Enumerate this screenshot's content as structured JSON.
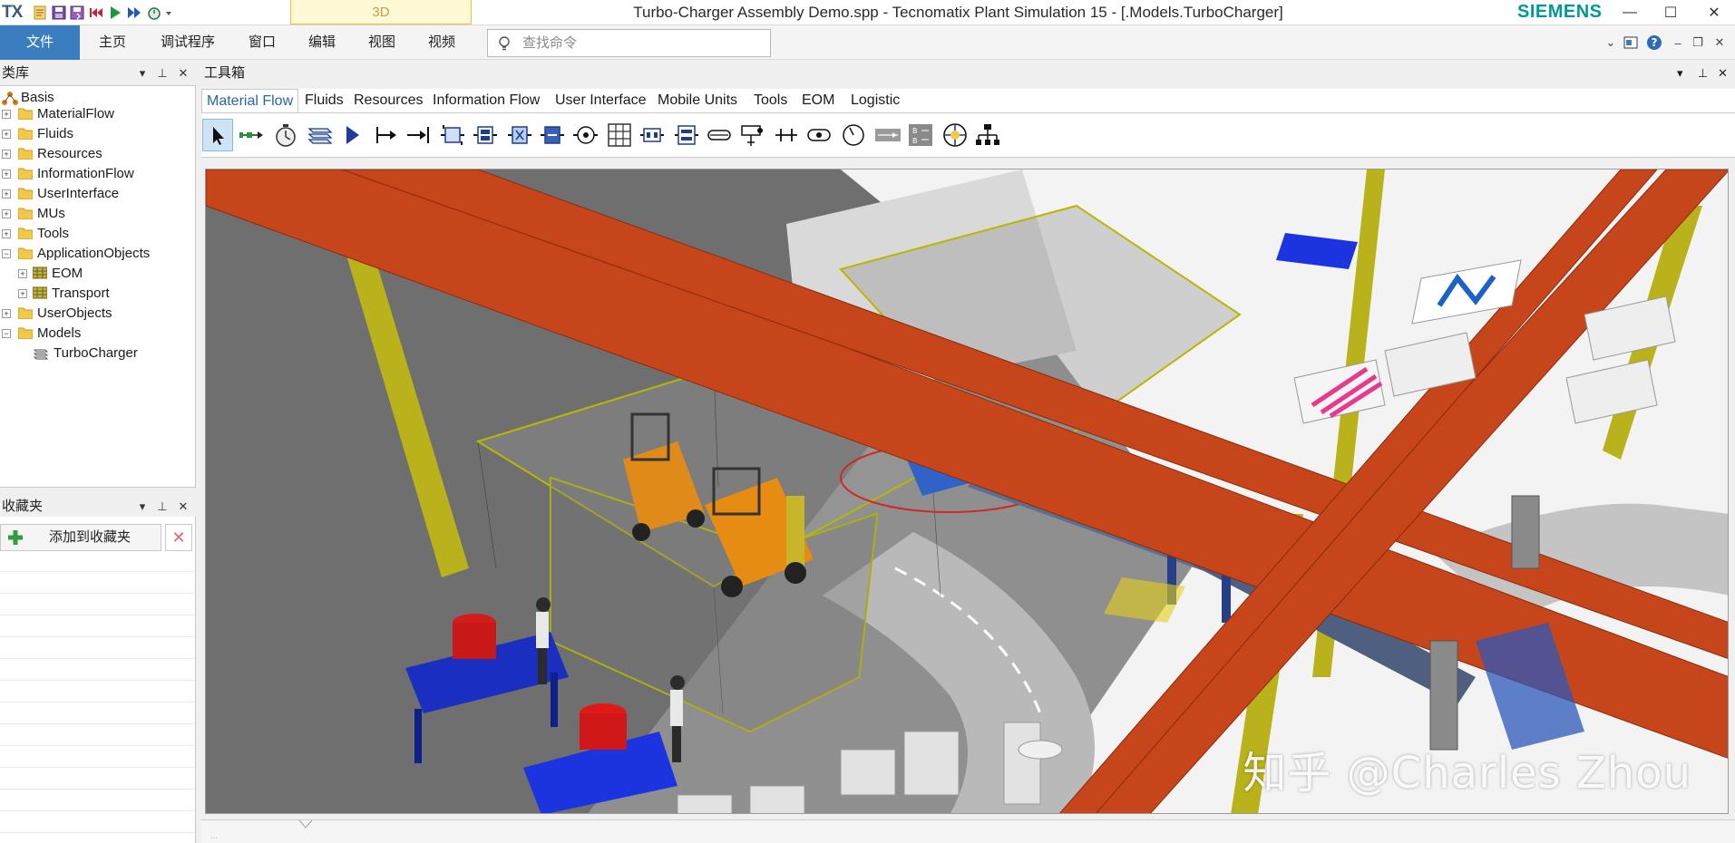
{
  "titlebar": {
    "logo": "TX",
    "tab_3d": "3D",
    "title": "Turbo-Charger Assembly Demo.spp - Tecnomatix Plant Simulation 15 - [.Models.TurboCharger]",
    "brand": "SIEMENS",
    "quick_access_icons": [
      "new-file-icon",
      "save-icon",
      "save-as-icon",
      "reset-icon",
      "start-icon",
      "fast-forward-icon",
      "event-controller-icon",
      "customize-icon"
    ]
  },
  "menu": {
    "file": "文件",
    "home": "主页",
    "debugger": "调试程序",
    "window": "窗口",
    "edit": "编辑",
    "view": "视图",
    "video": "视频",
    "search_placeholder": "查找命令"
  },
  "library": {
    "title": "类库",
    "items": [
      {
        "label": "Basis"
      },
      {
        "label": "MaterialFlow"
      },
      {
        "label": "Fluids"
      },
      {
        "label": "Resources"
      },
      {
        "label": "InformationFlow"
      },
      {
        "label": "UserInterface"
      },
      {
        "label": "MUs"
      },
      {
        "label": "Tools"
      },
      {
        "label": "ApplicationObjects"
      },
      {
        "label": "EOM"
      },
      {
        "label": "Transport"
      },
      {
        "label": "UserObjects"
      },
      {
        "label": "Models"
      },
      {
        "label": "TurboCharger"
      }
    ]
  },
  "favorites": {
    "title": "收藏夹",
    "add_label": "添加到收藏夹"
  },
  "toolbox": {
    "title": "工具箱",
    "tabs": [
      "Material Flow",
      "Fluids",
      "Resources",
      "Information Flow",
      "User Interface",
      "Mobile Units",
      "Tools",
      "EOM",
      "Logistic"
    ],
    "active_tab": "Material Flow",
    "tools": [
      "pointer-icon",
      "connector-icon",
      "event-controller-icon",
      "frame-icon",
      "source-icon",
      "single-proc-icon",
      "drain-icon",
      "parallel-proc-icon",
      "assembly-icon",
      "dismantle-icon",
      "shift-icon",
      "buffer-icon",
      "store-icon",
      "sorter-icon",
      "cycle-icon",
      "line-icon",
      "turntable-icon",
      "turnplate-icon",
      "crossing-icon",
      "track-icon",
      "dwell-point-icon",
      "flow-control-icon",
      "transfer-icon",
      "exit-icon",
      "entry-icon",
      "hierarchy-icon"
    ]
  },
  "viewport": {
    "watermark": "知乎 @Charles Zhou"
  },
  "statusbar": {
    "tag": "..."
  }
}
